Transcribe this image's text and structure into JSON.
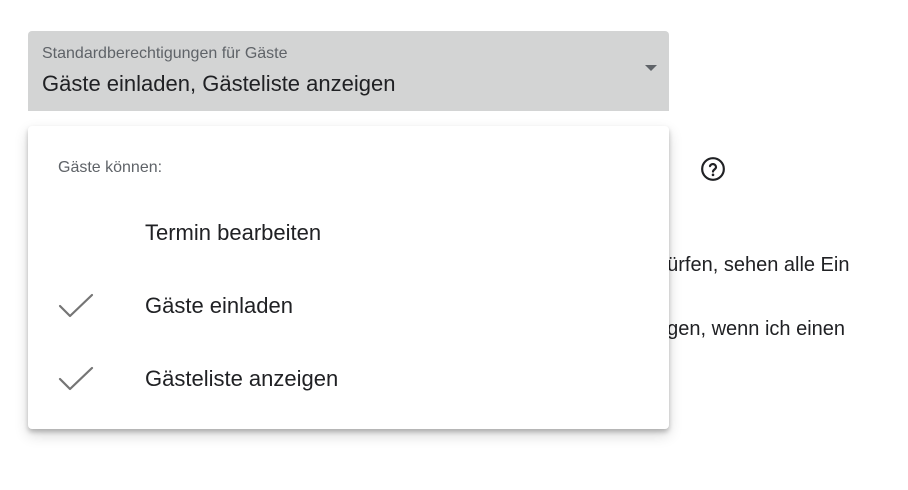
{
  "select": {
    "label": "Standardberechtigungen für Gäste",
    "value": "Gäste einladen, Gästeliste anzeigen"
  },
  "menu": {
    "header": "Gäste können:",
    "items": [
      {
        "label": "Termin bearbeiten",
        "checked": false
      },
      {
        "label": "Gäste einladen",
        "checked": true
      },
      {
        "label": "Gästeliste anzeigen",
        "checked": true
      }
    ]
  },
  "background": {
    "line_1": "dürfen, sehen alle Ein",
    "line_2": "ügen, wenn ich einen"
  },
  "icons": {
    "help": "help-circle-icon",
    "check": "check-icon",
    "dropdown": "chevron-down-icon"
  },
  "colors": {
    "select_background": "#d3d4d4",
    "text_primary": "#202124",
    "text_secondary": "#5f6368",
    "check": "#757575"
  }
}
